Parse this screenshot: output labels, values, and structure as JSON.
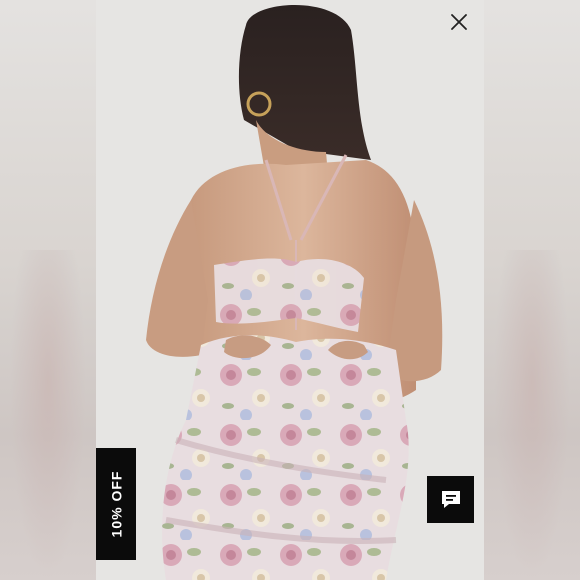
{
  "offer_tab": {
    "label": "10% OFF"
  },
  "icons": {
    "close": "close-icon",
    "chat": "chat-bubble-icon"
  },
  "colors": {
    "tab_background": "#0b0b0b",
    "tab_text": "#ffffff",
    "photo_background": "#e6e5e3"
  }
}
